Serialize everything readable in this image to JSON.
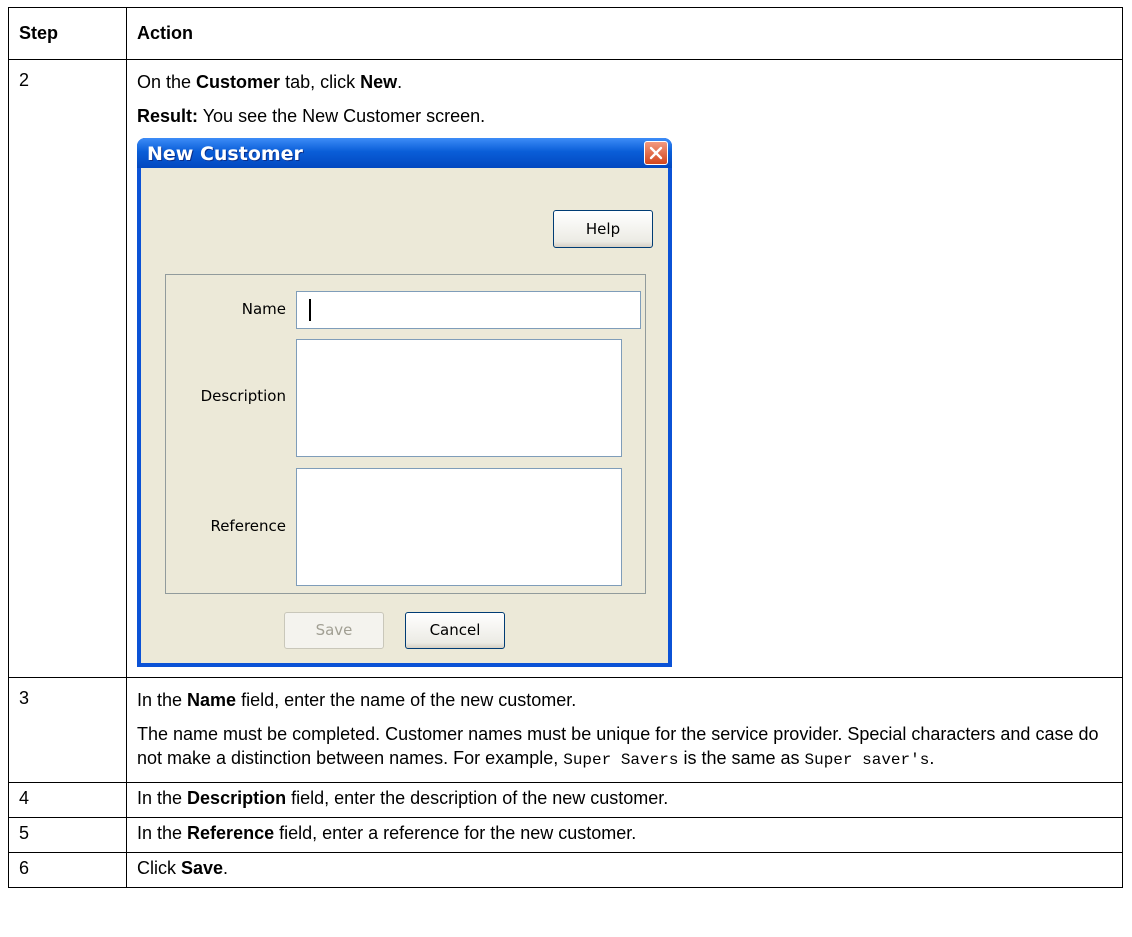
{
  "table": {
    "header": {
      "step": "Step",
      "action": "Action"
    },
    "row2": {
      "step": "2",
      "line1": {
        "pre": "On the ",
        "bold1": "Customer",
        "mid": " tab, click ",
        "bold2": "New",
        "post": "."
      },
      "result": {
        "label": "Result:",
        "text": " You see the New Customer screen."
      }
    },
    "row3": {
      "step": "3",
      "line1": {
        "pre": "In the ",
        "bold": "Name",
        "post": " field, enter the name of the new customer."
      },
      "para2": {
        "text": "The name must be completed. Customer names must be unique for the service provider. Special characters and case do not make a distinction between names. For example, ",
        "code1": "Super Savers",
        "mid": " is the same as ",
        "code2": "Super saver's",
        "post": "."
      }
    },
    "row4": {
      "step": "4",
      "pre": "In the ",
      "bold": "Description",
      "post": " field, enter the description of the new customer."
    },
    "row5": {
      "step": "5",
      "pre": "In the ",
      "bold": "Reference",
      "post": " field, enter a reference for the new customer."
    },
    "row6": {
      "step": "6",
      "pre": "Click ",
      "bold": "Save",
      "post": "."
    }
  },
  "dialog": {
    "title": "New Customer",
    "help_label": "Help",
    "name_label": "Name",
    "name_value": "",
    "description_label": "Description",
    "description_value": "",
    "reference_label": "Reference",
    "reference_value": "",
    "save_label": "Save",
    "cancel_label": "Cancel",
    "close_icon": "close-x-icon",
    "colors": {
      "titlebar": "#0a5ed8",
      "body": "#ece9d8",
      "close": "#d3461d"
    }
  }
}
